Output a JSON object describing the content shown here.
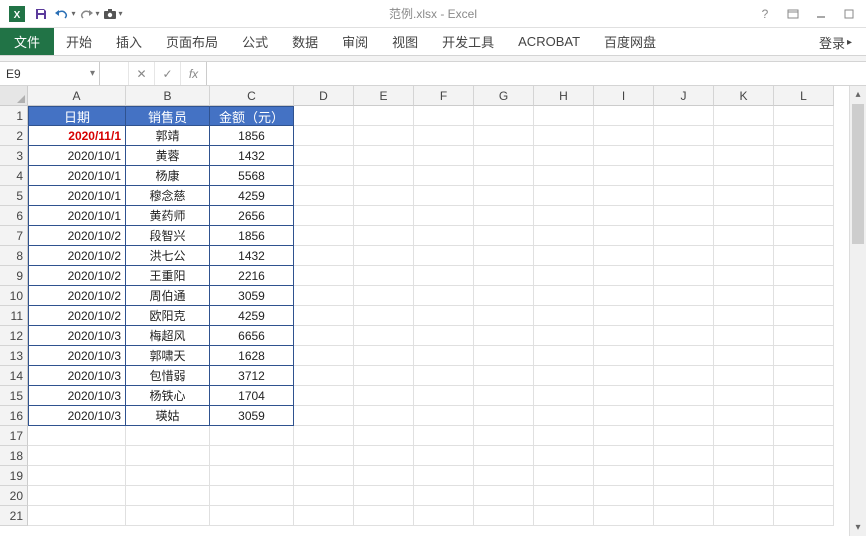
{
  "app": {
    "title": "范例.xlsx - Excel"
  },
  "qat": {
    "excel_icon": "excel-icon",
    "save_icon": "save-icon",
    "undo_icon": "undo-icon",
    "redo_icon": "redo-icon",
    "camera_icon": "camera-icon"
  },
  "ribbon": {
    "file": "文件",
    "tabs": [
      "开始",
      "插入",
      "页面布局",
      "公式",
      "数据",
      "审阅",
      "视图",
      "开发工具",
      "ACROBAT",
      "百度网盘"
    ],
    "login": "登录"
  },
  "namebox": {
    "value": "E9"
  },
  "grid": {
    "columns": [
      "A",
      "B",
      "C",
      "D",
      "E",
      "F",
      "G",
      "H",
      "I",
      "J",
      "K",
      "L"
    ],
    "headers": {
      "A": "日期",
      "B": "销售员",
      "C": "金额（元）"
    },
    "rows": [
      {
        "num": 1
      },
      {
        "num": 2,
        "A": "2020/11/1",
        "B": "郭靖",
        "C": "1856",
        "hl": true
      },
      {
        "num": 3,
        "A": "2020/10/1",
        "B": "黄蓉",
        "C": "1432"
      },
      {
        "num": 4,
        "A": "2020/10/1",
        "B": "杨康",
        "C": "5568"
      },
      {
        "num": 5,
        "A": "2020/10/1",
        "B": "穆念慈",
        "C": "4259"
      },
      {
        "num": 6,
        "A": "2020/10/1",
        "B": "黄药师",
        "C": "2656"
      },
      {
        "num": 7,
        "A": "2020/10/2",
        "B": "段智兴",
        "C": "1856"
      },
      {
        "num": 8,
        "A": "2020/10/2",
        "B": "洪七公",
        "C": "1432"
      },
      {
        "num": 9,
        "A": "2020/10/2",
        "B": "王重阳",
        "C": "2216"
      },
      {
        "num": 10,
        "A": "2020/10/2",
        "B": "周伯通",
        "C": "3059"
      },
      {
        "num": 11,
        "A": "2020/10/2",
        "B": "欧阳克",
        "C": "4259"
      },
      {
        "num": 12,
        "A": "2020/10/3",
        "B": "梅超风",
        "C": "6656"
      },
      {
        "num": 13,
        "A": "2020/10/3",
        "B": "郭啸天",
        "C": "1628"
      },
      {
        "num": 14,
        "A": "2020/10/3",
        "B": "包惜弱",
        "C": "3712"
      },
      {
        "num": 15,
        "A": "2020/10/3",
        "B": "杨铁心",
        "C": "1704"
      },
      {
        "num": 16,
        "A": "2020/10/3",
        "B": "瑛姑",
        "C": "3059"
      },
      {
        "num": 17
      },
      {
        "num": 18
      },
      {
        "num": 19
      },
      {
        "num": 20
      },
      {
        "num": 21
      }
    ]
  }
}
